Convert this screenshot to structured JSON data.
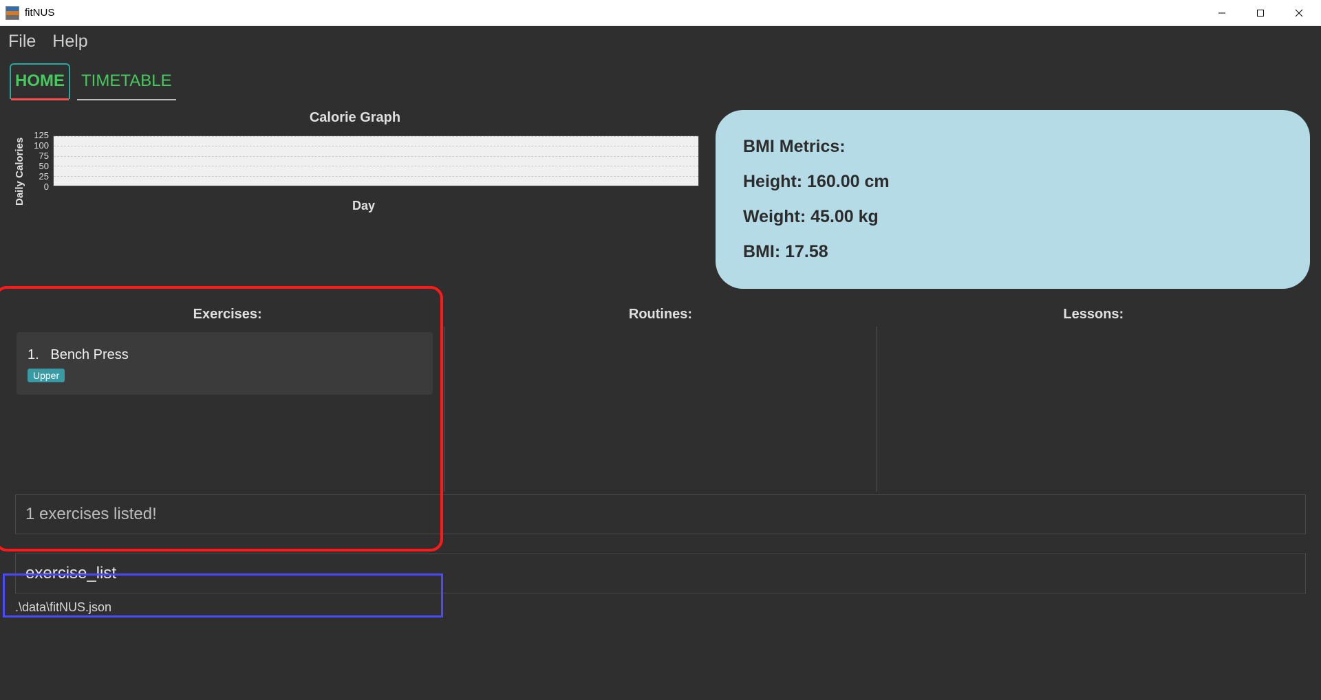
{
  "window": {
    "title": "fitNUS"
  },
  "menu": {
    "file": "File",
    "help": "Help"
  },
  "tabs": {
    "home": "HOME",
    "timetable": "TIMETABLE"
  },
  "chart_data": {
    "type": "bar",
    "title": "Calorie Graph",
    "xlabel": "Day",
    "ylabel": "Daily Calories",
    "ylim": [
      0,
      125
    ],
    "yticks": [
      125,
      100,
      75,
      50,
      25,
      0
    ],
    "categories": [],
    "values": []
  },
  "bmi": {
    "title": "BMI Metrics:",
    "height_label": "Height: 160.00 cm",
    "weight_label": "Weight: 45.00 kg",
    "bmi_label": "BMI: 17.58"
  },
  "columns": {
    "exercises_header": "Exercises:",
    "routines_header": "Routines:",
    "lessons_header": "Lessons:"
  },
  "exercises": [
    {
      "index": "1.",
      "name": "Bench Press",
      "tag": "Upper"
    }
  ],
  "status": {
    "message": "1 exercises listed!"
  },
  "command": {
    "value": "exercise_list"
  },
  "footer": {
    "path": ".\\data\\fitNUS.json"
  }
}
